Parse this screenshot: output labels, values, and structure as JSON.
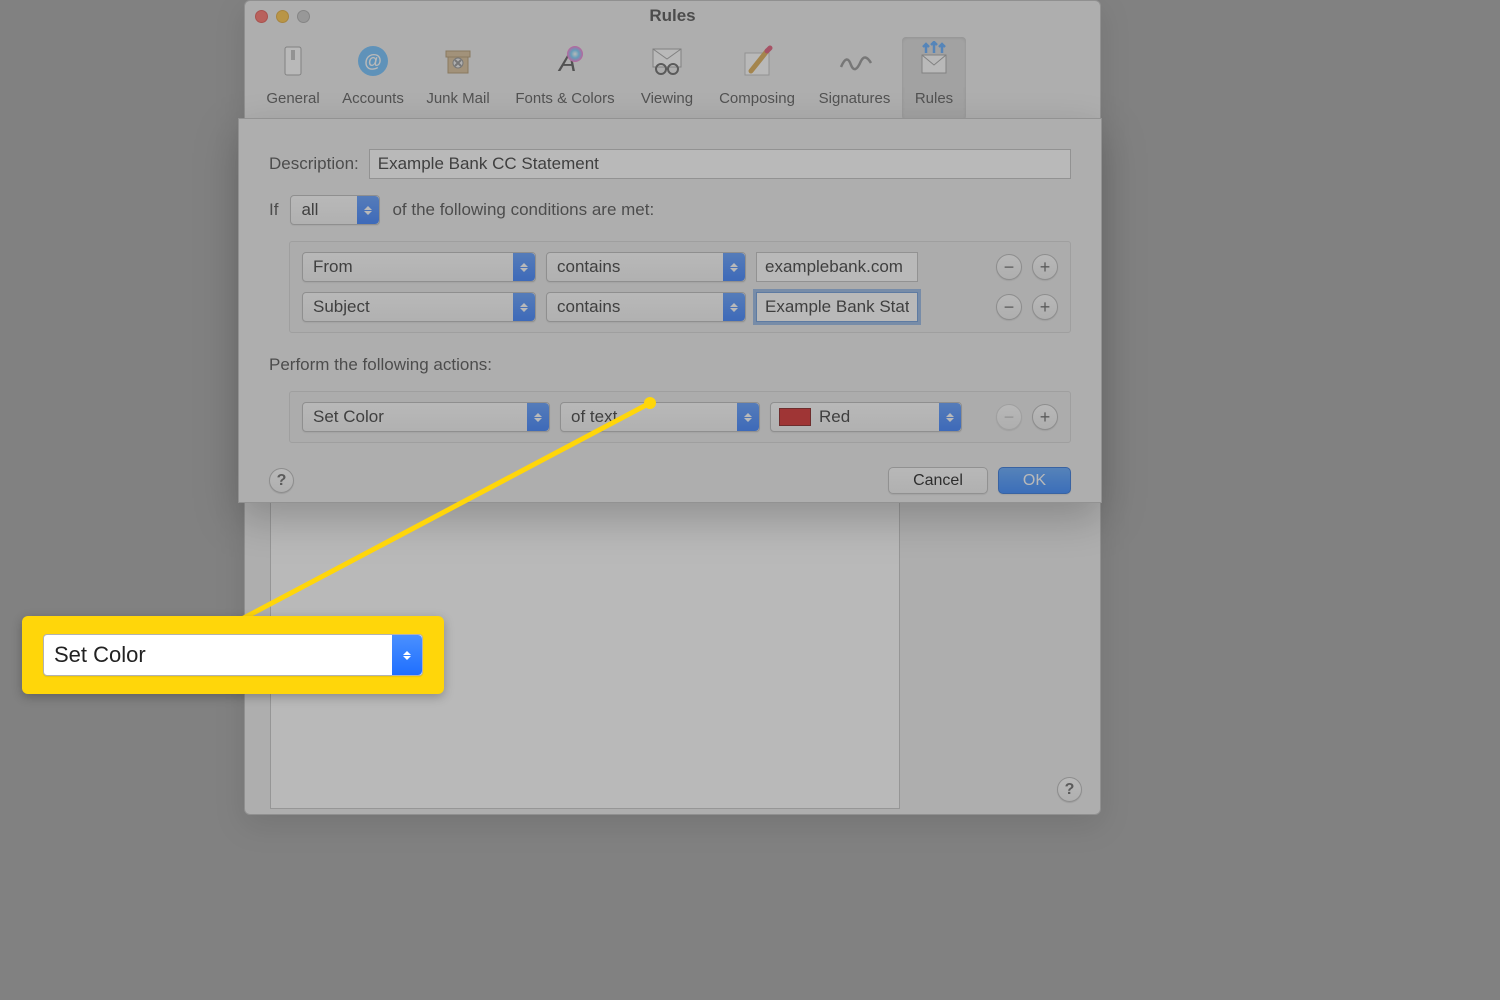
{
  "window": {
    "title": "Rules",
    "toolbar": {
      "items": [
        {
          "label": "General"
        },
        {
          "label": "Accounts"
        },
        {
          "label": "Junk Mail"
        },
        {
          "label": "Fonts & Colors"
        },
        {
          "label": "Viewing"
        },
        {
          "label": "Composing"
        },
        {
          "label": "Signatures"
        },
        {
          "label": "Rules"
        }
      ]
    }
  },
  "sheet": {
    "description_label": "Description:",
    "description_value": "Example Bank CC Statement",
    "if_prefix": "If",
    "if_mode": "all",
    "if_suffix": "of the following conditions are met:",
    "conditions": [
      {
        "field": "From",
        "op": "contains",
        "value": "examplebank.com"
      },
      {
        "field": "Subject",
        "op": "contains",
        "value": "Example Bank State"
      }
    ],
    "actions_label": "Perform the following actions:",
    "actions": [
      {
        "action": "Set Color",
        "target": "of text",
        "color_name": "Red"
      }
    ],
    "help": "?",
    "cancel": "Cancel",
    "ok": "OK"
  },
  "callout_label": "Set Color"
}
